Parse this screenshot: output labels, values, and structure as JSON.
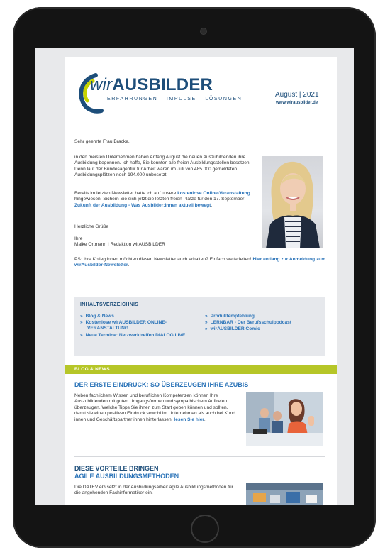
{
  "newsletter": {
    "logo": {
      "prefix": "wir",
      "brand": "AUSBILDER",
      "tagline": "ERFAHRUNGEN – IMPULSE – LÖSUNGEN"
    },
    "date": "August  | 2021",
    "website": "www.wirausbilder.de",
    "greeting": "Sehr geehrte Frau Bracke,",
    "intro": "in den meisten Unternehmen haben Anfang August die neuen Auszubildenden ihre Ausbildung begonnen. Ich hoffe, Sie konnten alle freien Ausbildungsstellen besetzen. Denn laut der Bundesagentur für Arbeit waren im Juli von 485.000 gemeldeten Ausbildungsplätzen noch 194.000 unbesetzt.",
    "para2_a": "Bereits im letzten Newsletter hatte ich auf unsere ",
    "para2_link1": "kostenlose Online-Veranstaltung",
    "para2_b": " hingewiesen. Sichern Sie sich jetzt die letzten freien Plätze für den 17. September: ",
    "para2_link2": "Zukunft der Ausbildung - Was Ausbilder:innen aktuell bewegt",
    "para2_c": ".",
    "closing": "Herzliche Grüße",
    "signature_line1": "Ihre",
    "signature_line2": "Maike Ortmann I Redaktion wirAUSBILDER",
    "ps_a": "PS: Ihre Kolleg:innen möchten diesen Newsletter auch erhalten? Einfach weiterleiten! ",
    "ps_link": "Hier entlang zur Anmeldung zum wirAusbilder-Newsletter",
    "ps_b": "."
  },
  "toc": {
    "title": "INHALTSVERZEICHNIS",
    "left": [
      "Blog & News",
      "Kostenlose wirAUSBILDER ONLINE-VERANSTALTUNG",
      "Neue Termine: Netzwerktreffen DIALOG LIVE"
    ],
    "right": [
      "Produktempfehlung",
      "LERNBAR - Der Berufsschulpodcast",
      "wirAUSBILDER Comic"
    ],
    "bullet": "»"
  },
  "section": {
    "label": "BLOG & NEWS",
    "article1": {
      "title_a": "DER ERSTE EINDRUCK: ",
      "title_b": "SO ÜBERZEUGEN IHRE AZUBIS",
      "text": "Neben fachlichem Wissen und beruflichen Kompetenzen können Ihre Auszubildenden mit guten Umgangsformen und sympathischem Auftreten überzeugen. Welche Tipps Sie ihnen zum Start geben können und sollten, damit sie einen positiven Eindruck sowohl im Unternehmen als auch bei Kund innen und Geschäftspartner innen hinterlassen, ",
      "link": "lesen Sie hier",
      "end": "."
    },
    "article2": {
      "title_line1": "DIESE VORTEILE BRINGEN",
      "title_line2": "AGILE AUSBILDUNGSMETHODEN",
      "text": "Die DATEV eG setzt in der Ausbildungsarbeit agile Ausbildungsmethoden für die angehenden Fachinformatiker ein."
    }
  },
  "colors": {
    "brand_blue": "#1d4e7a",
    "link_blue": "#2a73b8",
    "accent_green": "#b6c628",
    "device_black": "#141414"
  }
}
